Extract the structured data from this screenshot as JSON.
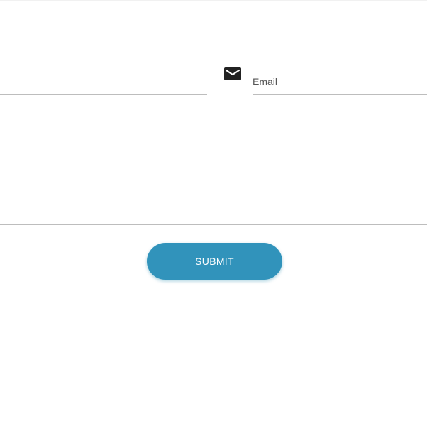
{
  "form": {
    "email": {
      "placeholder": "Email",
      "icon": "mail-icon"
    },
    "left_field": {
      "placeholder": ""
    },
    "message": {
      "placeholder": ""
    },
    "submit_label": "SUBMIT"
  },
  "colors": {
    "button_bg": "#3193bb",
    "button_text": "#ffffff",
    "underline": "#bdbdbd",
    "icon": "#222222"
  }
}
